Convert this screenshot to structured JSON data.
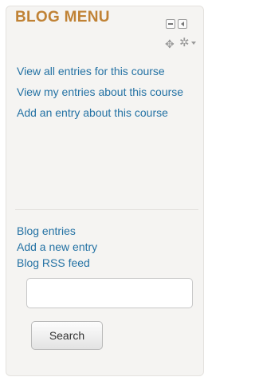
{
  "block": {
    "title": "BLOG MENU",
    "controls": {
      "hide_icon": "minus-box-icon",
      "dock_icon": "dock-arrow-icon",
      "move_icon": "move-cross-icon",
      "gear_icon": "gear-icon",
      "move_glyph": "✥",
      "gear_glyph": "✲"
    },
    "course_links": [
      {
        "label": "View all entries for this course"
      },
      {
        "label": "View my entries about this course"
      },
      {
        "label": "Add an entry about this course"
      }
    ],
    "blog_links": [
      {
        "label": "Blog entries"
      },
      {
        "label": "Add a new entry"
      },
      {
        "label": "Blog RSS feed"
      }
    ],
    "search": {
      "value": "",
      "placeholder": "",
      "button_label": "Search"
    }
  },
  "colors": {
    "title": "#c08235",
    "link": "#2472a4",
    "block_background": "#f5f4f2"
  }
}
